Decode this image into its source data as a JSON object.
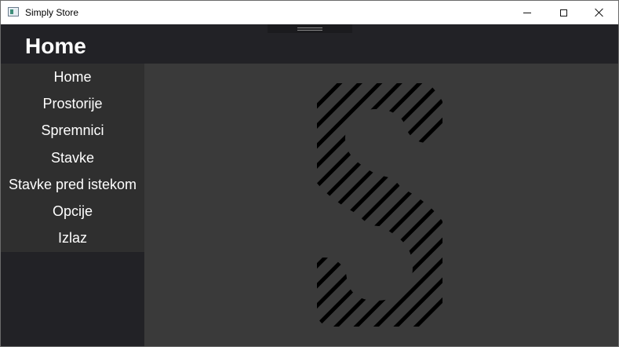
{
  "window": {
    "title": "Simply Store",
    "controls": [
      "minimize-icon",
      "maximize-icon",
      "close-icon"
    ]
  },
  "header": {
    "title": "Home"
  },
  "sidebar": {
    "items": [
      {
        "label": "Home"
      },
      {
        "label": "Prostorije"
      },
      {
        "label": "Spremnici"
      },
      {
        "label": "Stavke"
      },
      {
        "label": "Stavke pred istekom"
      },
      {
        "label": "Opcije"
      },
      {
        "label": "Izlaz"
      }
    ]
  },
  "main": {
    "logo": "striped-s-logo-icon"
  },
  "colors": {
    "header_bg": "#222226",
    "menu_bg": "#2f2f2f",
    "content_bg": "#3a3a3a",
    "text": "#ffffff"
  }
}
